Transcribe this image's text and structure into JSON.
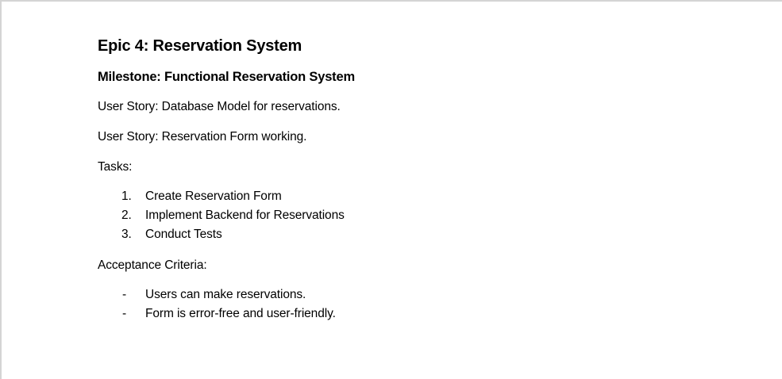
{
  "document": {
    "epic_title": "Epic 4: Reservation System",
    "milestone": "Milestone: Functional Reservation System",
    "user_stories": [
      "User Story: Database Model for reservations.",
      "User Story: Reservation Form working."
    ],
    "tasks_label": "Tasks:",
    "tasks": [
      {
        "marker": "1.",
        "text": "Create Reservation Form"
      },
      {
        "marker": "2.",
        "text": "Implement Backend for Reservations"
      },
      {
        "marker": "3.",
        "text": "Conduct Tests"
      }
    ],
    "acceptance_label": "Acceptance Criteria:",
    "acceptance_criteria": [
      {
        "marker": "-",
        "text": "Users can make reservations."
      },
      {
        "marker": "-",
        "text": "Form is error-free and user-friendly."
      }
    ]
  }
}
